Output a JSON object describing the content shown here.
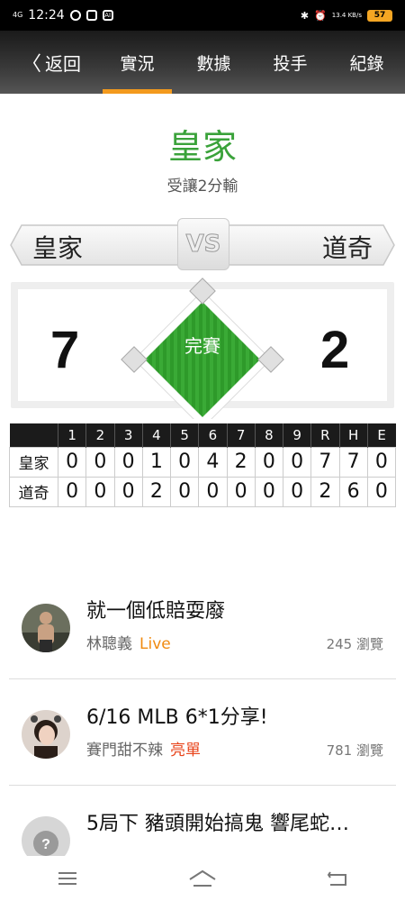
{
  "status_bar": {
    "network": "4G",
    "time": "12:24",
    "speed": "13.4 KB/s",
    "battery": "57"
  },
  "nav": {
    "back_label": "返回",
    "tabs": [
      "實況",
      "數據",
      "投手",
      "紀錄"
    ],
    "active_tab": "實況"
  },
  "result": {
    "winner": "皇家",
    "handicap_text": "受讓2分輸"
  },
  "matchup": {
    "home_team": "皇家",
    "away_team": "道奇",
    "vs_label": "VS"
  },
  "score": {
    "home": "7",
    "away": "2",
    "status": "完賽"
  },
  "linescore": {
    "headers": [
      "1",
      "2",
      "3",
      "4",
      "5",
      "6",
      "7",
      "8",
      "9",
      "R",
      "H",
      "E"
    ],
    "rows": [
      {
        "team": "皇家",
        "values": [
          "0",
          "0",
          "0",
          "1",
          "0",
          "4",
          "2",
          "0",
          "0",
          "7",
          "7",
          "0"
        ]
      },
      {
        "team": "道奇",
        "values": [
          "0",
          "0",
          "0",
          "2",
          "0",
          "0",
          "0",
          "0",
          "0",
          "2",
          "6",
          "0"
        ]
      }
    ]
  },
  "posts": [
    {
      "title": "就一個低賠耍廢",
      "author": "林聰義",
      "tag": "Live",
      "views": "245 瀏覽"
    },
    {
      "title": "6/16 MLB 6*1分享!",
      "author": "賽門甜不辣",
      "tag": "亮單",
      "views": "781 瀏覽"
    },
    {
      "title": "5局下 豬頭開始搞鬼 響尾蛇…",
      "author": "",
      "tag": "",
      "views": ""
    }
  ],
  "colors": {
    "accent": "#f39a1e",
    "winner_green": "#3aa23a",
    "field_green": "#2e9a2a",
    "live_orange": "#f08a10",
    "hot_red": "#e8451c"
  }
}
